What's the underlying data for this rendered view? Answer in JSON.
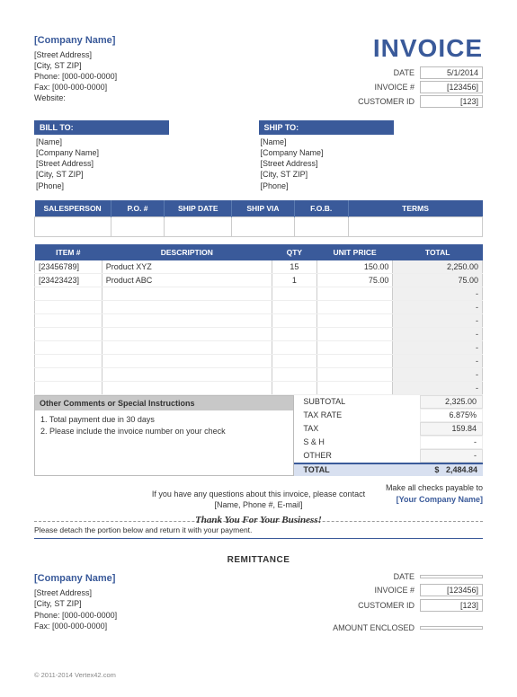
{
  "company": {
    "name": "[Company Name]",
    "street": "[Street Address]",
    "city": "[City, ST  ZIP]",
    "phone_label": "Phone:",
    "phone": "[000-000-0000]",
    "fax_label": "Fax:",
    "fax": "[000-000-0000]",
    "website_label": "Website:"
  },
  "invoice_title": "INVOICE",
  "meta": {
    "date_label": "DATE",
    "date": "5/1/2014",
    "invoice_no_label": "INVOICE #",
    "invoice_no": "[123456]",
    "customer_id_label": "CUSTOMER ID",
    "customer_id": "[123]"
  },
  "bill_to": {
    "head": "BILL TO:",
    "name": "[Name]",
    "company": "[Company Name]",
    "street": "[Street Address]",
    "city": "[City, ST  ZIP]",
    "phone": "[Phone]"
  },
  "ship_to": {
    "head": "SHIP TO:",
    "name": "[Name]",
    "company": "[Company Name]",
    "street": "[Street Address]",
    "city": "[City, ST  ZIP]",
    "phone": "[Phone]"
  },
  "sales_headers": {
    "salesperson": "SALESPERSON",
    "po": "P.O. #",
    "ship_date": "SHIP DATE",
    "ship_via": "SHIP VIA",
    "fob": "F.O.B.",
    "terms": "TERMS"
  },
  "item_headers": {
    "item": "ITEM #",
    "desc": "DESCRIPTION",
    "qty": "QTY",
    "unit": "UNIT PRICE",
    "total": "TOTAL"
  },
  "items": [
    {
      "item": "[23456789]",
      "desc": "Product XYZ",
      "qty": "15",
      "unit": "150.00",
      "total": "2,250.00"
    },
    {
      "item": "[23423423]",
      "desc": "Product ABC",
      "qty": "1",
      "unit": "75.00",
      "total": "75.00"
    }
  ],
  "empty_dash": "-",
  "comments": {
    "head": "Other Comments or Special Instructions",
    "line1": "1. Total payment due in 30 days",
    "line2": "2. Please include the invoice number on your check"
  },
  "totals": {
    "subtotal_label": "SUBTOTAL",
    "subtotal": "2,325.00",
    "taxrate_label": "TAX RATE",
    "taxrate": "6.875%",
    "tax_label": "TAX",
    "tax": "159.84",
    "sh_label": "S & H",
    "sh": "-",
    "other_label": "OTHER",
    "other": "-",
    "total_label": "TOTAL",
    "total_currency": "$",
    "total": "2,484.84"
  },
  "contact": {
    "line1": "If you have any questions about this invoice, please contact",
    "line2": "[Name, Phone #, E-mail]",
    "thanks": "Thank You For Your Business!"
  },
  "payable": {
    "line1": "Make all checks payable to",
    "line2": "[Your Company Name]"
  },
  "detach": "Please detach the portion below and return it with your payment.",
  "remittance": {
    "title": "REMITTANCE",
    "date_label": "DATE",
    "date": "",
    "invoice_no_label": "INVOICE #",
    "invoice_no": "[123456]",
    "customer_id_label": "CUSTOMER ID",
    "customer_id": "[123]",
    "amount_label": "AMOUNT ENCLOSED",
    "amount": ""
  },
  "footer": {
    "copyright": "© 2011-2014 Vertex42.com",
    "link": "https://www.vertex42.com/ExcelTemplates/invoice-templates.html"
  }
}
